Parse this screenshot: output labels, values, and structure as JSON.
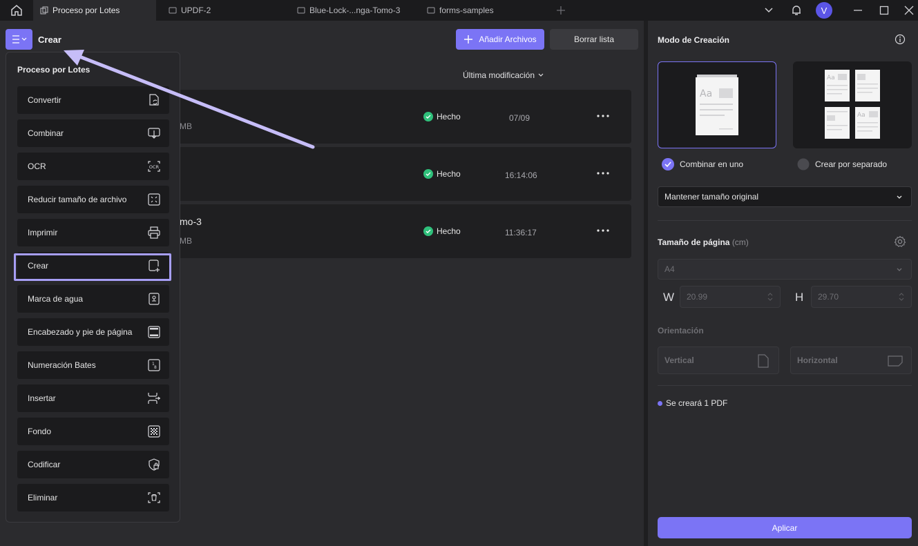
{
  "titlebar": {
    "tabs": [
      {
        "label": "Proceso por Lotes",
        "active": true
      },
      {
        "label": "UPDF-2",
        "active": false
      },
      {
        "label": "Blue-Lock-...nga-Tomo-3",
        "active": false
      },
      {
        "label": "forms-samples",
        "active": false
      }
    ],
    "avatar_letter": "V"
  },
  "header": {
    "title": "Crear",
    "add_files_label": "Añadir Archivos",
    "clear_list_label": "Borrar lista",
    "sort_label": "Última modificación"
  },
  "files": [
    {
      "name": "",
      "size": "MB",
      "status": "Hecho",
      "time": "07/09"
    },
    {
      "name": "",
      "size": "",
      "status": "Hecho",
      "time": "16:14:06"
    },
    {
      "name": "mo-3",
      "size": "MB",
      "status": "Hecho",
      "time": "11:36:17"
    }
  ],
  "dropdown": {
    "title": "Proceso por Lotes",
    "items": [
      {
        "label": "Convertir",
        "icon": "convert-icon"
      },
      {
        "label": "Combinar",
        "icon": "combine-icon"
      },
      {
        "label": "OCR",
        "icon": "ocr-icon"
      },
      {
        "label": "Reducir tamaño de archivo",
        "icon": "compress-icon"
      },
      {
        "label": "Imprimir",
        "icon": "print-icon"
      },
      {
        "label": "Crear",
        "icon": "create-icon",
        "selected": true
      },
      {
        "label": "Marca de agua",
        "icon": "watermark-icon"
      },
      {
        "label": "Encabezado y pie de página",
        "icon": "header-footer-icon"
      },
      {
        "label": "Numeración Bates",
        "icon": "bates-icon"
      },
      {
        "label": "Insertar",
        "icon": "insert-icon"
      },
      {
        "label": "Fondo",
        "icon": "background-icon"
      },
      {
        "label": "Codificar",
        "icon": "encrypt-icon"
      },
      {
        "label": "Eliminar",
        "icon": "delete-icon"
      }
    ]
  },
  "right_panel": {
    "title": "Modo de Creación",
    "combine_label": "Combinar en uno",
    "separate_label": "Crear por separado",
    "size_option": "Mantener tamaño original",
    "page_size_title": "Tamaño de página",
    "page_size_unit": "(cm)",
    "page_size_value": "A4",
    "w_label": "W",
    "w_value": "20.99",
    "h_label": "H",
    "h_value": "29.70",
    "orientation_title": "Orientación",
    "vertical_label": "Vertical",
    "horizontal_label": "Horizontal",
    "info": "Se creará 1 PDF",
    "apply_label": "Aplicar"
  },
  "colors": {
    "accent": "#7b74f5",
    "success": "#2fc07b"
  }
}
